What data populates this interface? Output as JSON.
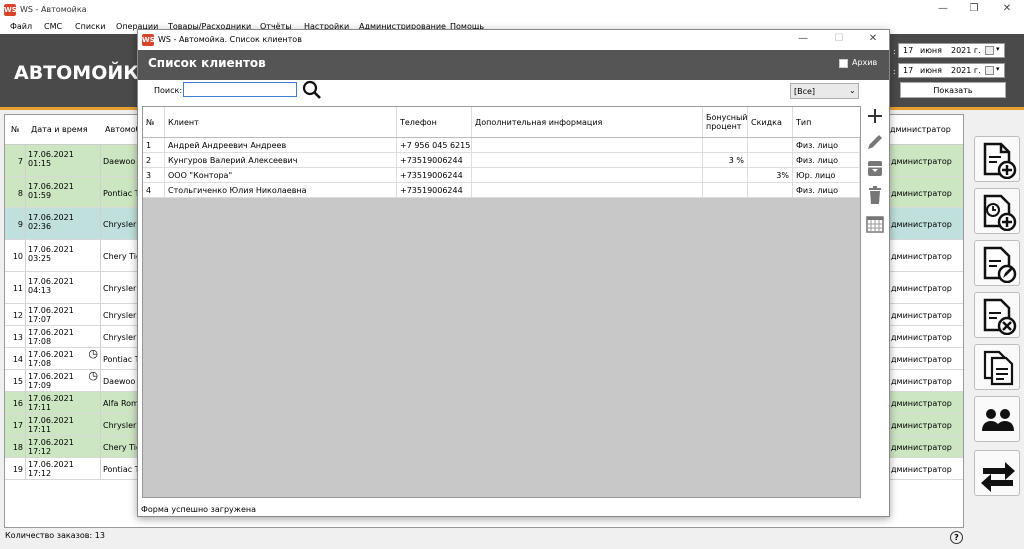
{
  "main_window": {
    "title": "WS - Автомойка",
    "app_icon": "WS"
  },
  "menu": [
    "Файл",
    "СМС",
    "Списки",
    "Операции",
    "Товары/Расходники",
    "Отчёты",
    "Настройки",
    "Администрирование",
    "Помощь"
  ],
  "brand": "АВТОМОЙКА",
  "date_from": {
    "day": "17",
    "month": "июня",
    "year": "2021 г."
  },
  "date_to": {
    "day": "17",
    "month": "июня",
    "year": "2021 г."
  },
  "show_button": "Показать",
  "orders_grid": {
    "headers": {
      "num": "№",
      "datetime": "Дата и время",
      "auto": "Автомоб",
      "admin": "дминистратор"
    },
    "rows": [
      {
        "n": "7",
        "d": "17.06.2021",
        "t": "01:15",
        "car": "Daewoo N",
        "admin": "дминистратор",
        "c": "green"
      },
      {
        "n": "8",
        "d": "17.06.2021",
        "t": "01:59",
        "car": "Pontiac T",
        "admin": "дминистратор",
        "c": "green"
      },
      {
        "n": "9",
        "d": "17.06.2021",
        "t": "02:36",
        "car": "Chrysler C",
        "admin": "дминистратор",
        "c": "teal"
      },
      {
        "n": "10",
        "d": "17.06.2021",
        "t": "03:25",
        "car": "Chery Tig",
        "admin": "дминистратор",
        "c": "white"
      },
      {
        "n": "11",
        "d": "17.06.2021",
        "t": "04:13",
        "car": "Chrysler C",
        "admin": "дминистратор",
        "c": "white"
      },
      {
        "n": "12",
        "d": "17.06.2021",
        "t": "17:07",
        "car": "Chrysler C",
        "admin": "дминистратор",
        "c": "white"
      },
      {
        "n": "13",
        "d": "17.06.2021",
        "t": "17:08",
        "car": "Chrysler C",
        "admin": "дминистратор",
        "c": "white"
      },
      {
        "n": "14",
        "d": "17.06.2021",
        "t": "17:08",
        "car": "Pontiac Te",
        "admin": "дминистратор",
        "c": "white",
        "clock": true
      },
      {
        "n": "15",
        "d": "17.06.2021",
        "t": "17:09",
        "car": "Daewoo N",
        "admin": "дминистратор",
        "c": "white",
        "clock": true
      },
      {
        "n": "16",
        "d": "17.06.2021",
        "t": "17:11",
        "car": "Alfa Rom",
        "admin": "дминистратор",
        "c": "green"
      },
      {
        "n": "17",
        "d": "17.06.2021",
        "t": "17:11",
        "car": "Chrysler C",
        "admin": "дминистратор",
        "c": "green"
      },
      {
        "n": "18",
        "d": "17.06.2021",
        "t": "17:12",
        "car": "Chery Tig",
        "admin": "дминистратор",
        "c": "green"
      },
      {
        "n": "19",
        "d": "17.06.2021",
        "t": "17:12",
        "car": "Pontiac Te",
        "admin": "дминистратор",
        "c": "white"
      }
    ]
  },
  "orders_count": "Количество заказов: 13",
  "right_buttons": [
    "new-order-icon",
    "scheduled-order-icon",
    "edit-order-icon",
    "delete-order-icon",
    "copy-order-icon",
    "clients-icon",
    "transfer-icon"
  ],
  "dialog": {
    "title": "WS - Автомойка. Список клиентов",
    "header": "Список клиентов",
    "archive_label": "Архив",
    "search_label": "Поиск:",
    "search_value": "",
    "filter_value": "[Все]",
    "columns": [
      "№",
      "Клиент",
      "Телефон",
      "Дополнительная информация",
      "Бонусный процент",
      "Скидка",
      "Тип"
    ],
    "clients": [
      {
        "n": "1",
        "name": "Андрей Андреевич Андреев",
        "phone": "+7 956 045 6215",
        "info": "",
        "bonus": "",
        "discount": "",
        "type": "Физ. лицо"
      },
      {
        "n": "2",
        "name": "Кунгуров Валерий Алексеевич",
        "phone": "+73519006244",
        "info": "",
        "bonus": "3 %",
        "discount": "",
        "type": "Физ. лицо"
      },
      {
        "n": "3",
        "name": "ООО \"Контора\"",
        "phone": "+73519006244",
        "info": "",
        "bonus": "",
        "discount": "3%",
        "type": "Юр. лицо"
      },
      {
        "n": "4",
        "name": "Стольгиченко Юлия Николаевна",
        "phone": "+73519006244",
        "info": "",
        "bonus": "",
        "discount": "",
        "type": "Физ. лицо"
      }
    ],
    "status": "Форма успешно загружена"
  }
}
